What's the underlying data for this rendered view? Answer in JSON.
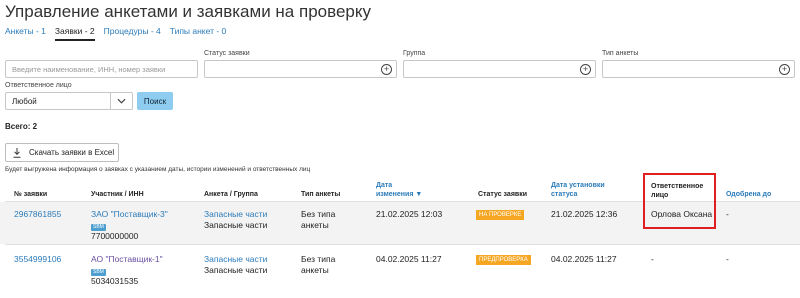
{
  "page": {
    "title": "Управление анкетами и заявками на проверку"
  },
  "tabs": [
    {
      "label": "Анкеты - 1"
    },
    {
      "label": "Заявки - 2"
    },
    {
      "label": "Процедуры - 4"
    },
    {
      "label": "Типы анкет - 0"
    }
  ],
  "active_tab": "Заявки - 2",
  "filters": {
    "search_placeholder": "Введите наименование, ИНН, номер заявки",
    "status_label": "Статус заявки",
    "group_label": "Группа",
    "type_label": "Тип анкеты",
    "responsible_label": "Ответственное лицо",
    "responsible_value": "Любой",
    "search_button": "Поиск"
  },
  "total": "Всего: 2",
  "excel_button": "Скачать заявки в Excel",
  "export_note": "Будет выгружена информация о заявках с указанием даты, истории изменений и ответственных лиц",
  "table": {
    "headers": {
      "number": "№ заявки",
      "participant": "Участник / ИНН",
      "form_group": "Анкета / Группа",
      "form_type": "Тип анкеты",
      "changed_l1": "Дата",
      "changed_l2": "изменения",
      "sort_arrow": "▼",
      "status": "Статус заявки",
      "status_date_l1": "Дата установки",
      "status_date_l2": "статуса",
      "responsible_l1": "Ответственное",
      "responsible_l2": "лицо",
      "approved": "Одобрена до"
    },
    "rows": [
      {
        "number": "2967861855",
        "participant": "ЗАО \"Поставщик-3\"",
        "badge": "SBM",
        "inn": "7700000000",
        "form": "Запасные части",
        "group": "Запасные части",
        "type_l1": "Без типа",
        "type_l2": "анкеты",
        "changed": "21.02.2025 12:03",
        "status": "НА ПРОВЕРКЕ",
        "status_date": "21.02.2025 12:36",
        "responsible": "Орлова Оксана",
        "approved": "-"
      },
      {
        "number": "3554999106",
        "participant": "АО \"Поставщик-1\"",
        "badge": "SBM",
        "inn": "5034031535",
        "form": "Запасные части",
        "group": "Запасные части",
        "type_l1": "Без типа",
        "type_l2": "анкеты",
        "changed": "04.02.2025 11:27",
        "status": "ПРЕДПРОВЕРКА",
        "status_date": "04.02.2025 11:27",
        "responsible": "-",
        "approved": "-"
      }
    ]
  },
  "colors": {
    "accent": "#2b7bb9",
    "status_badge": "#f5a623",
    "search_button": "#8fcdf0",
    "highlight": "#e02020"
  }
}
